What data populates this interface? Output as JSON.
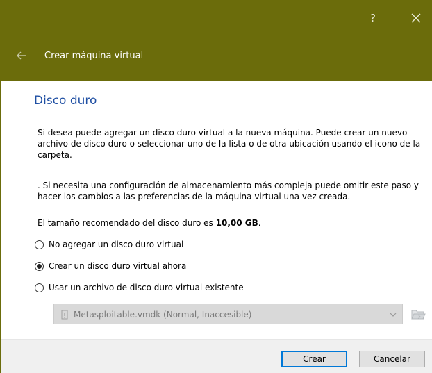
{
  "window": {
    "help_label": "?",
    "title": "Crear máquina virtual",
    "accent_color": "#6b6c0b"
  },
  "page": {
    "section_title": "Disco duro",
    "paragraph_1": "Si desea puede agregar un disco duro virtual a la nueva máquina. Puede crear un nuevo archivo de disco duro o seleccionar uno de la lista o de otra ubicación usando el icono de la carpeta.",
    "paragraph_2": ". Si necesita una configuración de almacenamiento más compleja puede omitir este paso y hacer los cambios a las preferencias de la máquina virtual una vez creada.",
    "recommended_prefix": "El tamaño recomendado del disco duro es ",
    "recommended_size": "10,00 GB",
    "recommended_suffix": "."
  },
  "options": [
    {
      "label": "No agregar un disco duro virtual",
      "checked": false
    },
    {
      "label": "Crear un disco duro virtual ahora",
      "checked": true
    },
    {
      "label": "Usar un archivo de disco duro virtual existente",
      "checked": false
    }
  ],
  "disk_select": {
    "value": "Metasploitable.vmdk (Normal, Inaccesible)",
    "disabled": true,
    "icon": "warning-disk-icon"
  },
  "icons": {
    "close": "close-icon",
    "back": "back-arrow-icon",
    "folder": "folder-open-icon",
    "dropdown": "chevron-down-icon"
  },
  "buttons": {
    "create": "Crear",
    "cancel": "Cancelar"
  }
}
